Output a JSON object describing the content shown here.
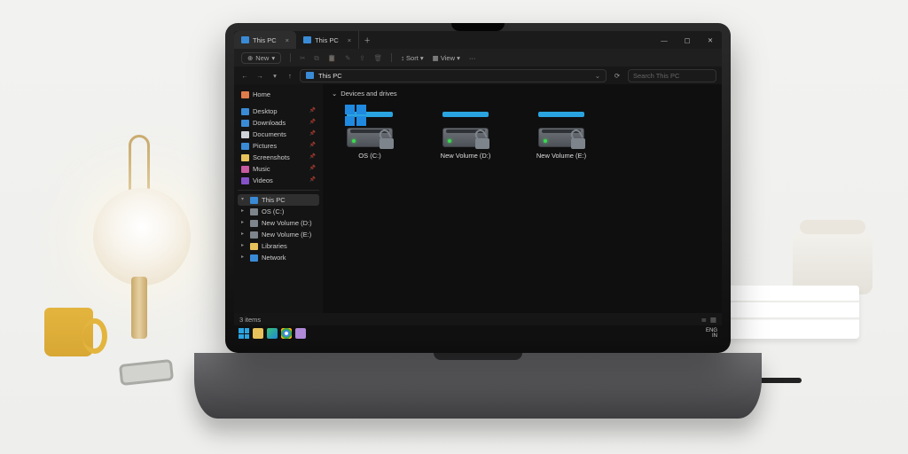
{
  "tabs": [
    {
      "title": "This PC",
      "active": true
    },
    {
      "title": "This PC",
      "active": false
    }
  ],
  "toolbar": {
    "new_label": "New",
    "sort_label": "Sort",
    "view_label": "View"
  },
  "address": {
    "location": "This PC",
    "search_placeholder": "Search This PC"
  },
  "sidebar": {
    "home": "Home",
    "quick": [
      {
        "label": "Desktop",
        "glyph": "g-desktop"
      },
      {
        "label": "Downloads",
        "glyph": "g-down"
      },
      {
        "label": "Documents",
        "glyph": "g-doc"
      },
      {
        "label": "Pictures",
        "glyph": "g-pic"
      },
      {
        "label": "Screenshots",
        "glyph": "g-scr"
      },
      {
        "label": "Music",
        "glyph": "g-music"
      },
      {
        "label": "Videos",
        "glyph": "g-video"
      }
    ],
    "this_pc": "This PC",
    "drives": [
      {
        "label": "OS (C:)"
      },
      {
        "label": "New Volume (D:)"
      },
      {
        "label": "New Volume (E:)"
      }
    ],
    "libraries": "Libraries",
    "network": "Network"
  },
  "content": {
    "group_header": "Devices and drives",
    "drives": [
      {
        "label": "OS (C:)",
        "os_logo": true,
        "unlocked": true
      },
      {
        "label": "New Volume (D:)",
        "os_logo": false,
        "unlocked": true
      },
      {
        "label": "New Volume (E:)",
        "os_logo": false,
        "unlocked": true
      }
    ]
  },
  "status": {
    "items_label": "3 items"
  },
  "taskbar": {
    "lang1": "ENG",
    "lang2": "IN"
  }
}
